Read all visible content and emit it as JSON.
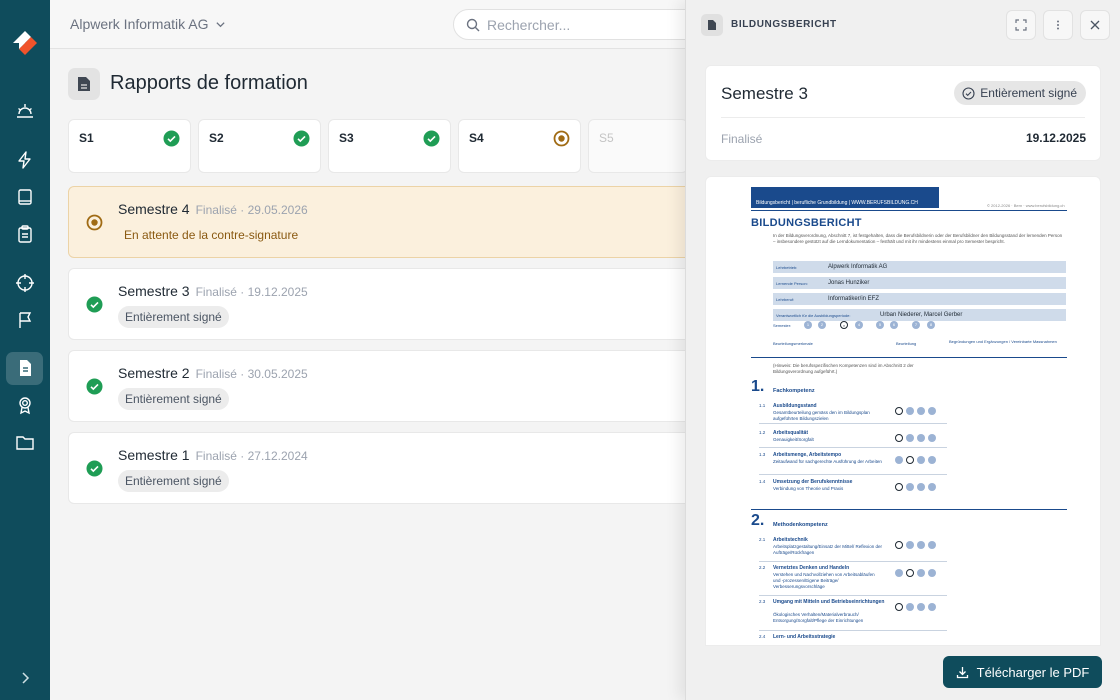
{
  "app": {
    "org_name": "Alpwerk Informatik AG",
    "search_placeholder": "Rechercher...",
    "page_title": "Rapports de formation"
  },
  "sidebar": {
    "items": [
      {
        "icon": "sunrise-icon"
      },
      {
        "icon": "lightning-icon"
      },
      {
        "icon": "book-icon"
      },
      {
        "icon": "clipboard-icon"
      },
      {
        "icon": "target-icon"
      },
      {
        "icon": "flag-icon"
      },
      {
        "icon": "document-icon",
        "active": true
      },
      {
        "icon": "award-icon"
      },
      {
        "icon": "folder-icon"
      }
    ]
  },
  "tabs": [
    {
      "label": "S1",
      "state": "done"
    },
    {
      "label": "S2",
      "state": "done"
    },
    {
      "label": "S3",
      "state": "done"
    },
    {
      "label": "S4",
      "state": "pending"
    },
    {
      "label": "S5",
      "state": "disabled"
    }
  ],
  "reports": [
    {
      "title": "Semestre 4",
      "meta": "Finalisé · 29.05.2026",
      "status": "En attente de la contre-signature",
      "state": "pending"
    },
    {
      "title": "Semestre 3",
      "meta": "Finalisé · 19.12.2025",
      "status": "Entièrement signé",
      "state": "done"
    },
    {
      "title": "Semestre 2",
      "meta": "Finalisé · 30.05.2025",
      "status": "Entièrement signé",
      "state": "done"
    },
    {
      "title": "Semestre 1",
      "meta": "Finalisé · 27.12.2024",
      "status": "Entièrement signé",
      "state": "done"
    }
  ],
  "drawer": {
    "title": "BILDUNGSBERICHT",
    "semester": "Semestre 3",
    "status": "Entièrement signé",
    "finalized_label": "Finalisé",
    "finalized_date": "19.12.2025",
    "download_label": "Télécharger le PDF"
  },
  "colors": {
    "sidebar": "#0f4c5c",
    "success": "#1f9d55",
    "pending": "#a06b14",
    "doc_blue": "#1a4a8c"
  },
  "document": {
    "bar_text": "Bildungsbericht | berufliche Grundbildung | WWW.BERUFSBILDUNG.CH",
    "copyright": "© 2012-2026 · Bern · www.berufsbildung.ch",
    "heading": "BILDUNGSBERICHT",
    "intro": "In der Bildungsverordnung, Abschnitt 7, ist festgehalten, dass die Berufsbildnerin oder der Berufsbildner den Bildungsstand der lernenden Person – insbesondere gestützt auf die Lerndokumentation – festhält und mit ihr mindestens einmal pro Semester bespricht.",
    "fields": [
      {
        "label": "Lehrbetrieb:",
        "value": "Alpwerk Informatik AG"
      },
      {
        "label": "Lernende Person:",
        "value": "Jonas Hunziker"
      },
      {
        "label": "Lehrberuf:",
        "value": "Informatiker/in EFZ"
      },
      {
        "label": "Verantwortlich für die Ausbildungsperiode:",
        "value": "Urban Niederer, Marcel Gerber"
      }
    ],
    "semester_label": "Semester:",
    "columns": [
      "Beurteilungsmerkmale",
      "Beurteilung",
      "Begründungen und Ergänzungen / Vereinbarte Massnahmen"
    ],
    "section_hint": "(Hinweis: Die berufsspezifischen Kompetenzen sind im Abschnitt 2 der Bildungsverordnung aufgeführt.)",
    "sections": [
      {
        "num": "1.",
        "title": "Fachkompetenz",
        "items": [
          {
            "num": "1.1",
            "title": "Ausbildungsstand",
            "sub": "Gesamtbeurteilung gemäss den im Bildungsplan aufgeführten Bildungszielen",
            "mark": 0
          },
          {
            "num": "1.2",
            "title": "Arbeitsqualität",
            "sub": "Genauigkeit/Sorgfalt",
            "mark": 0
          },
          {
            "num": "1.3",
            "title": "Arbeitsmenge, Arbeitstempo",
            "sub": "Zeitaufwand für sachgerechte Ausführung der Arbeiten",
            "mark": 1
          },
          {
            "num": "1.4",
            "title": "Umsetzung der Berufskenntnisse",
            "sub": "Verbindung von Theorie und Praxis",
            "mark": 0
          }
        ]
      },
      {
        "num": "2.",
        "title": "Methodenkompetenz",
        "items": [
          {
            "num": "2.1",
            "title": "Arbeitstechnik",
            "sub": "Arbeitsplatzgestaltung/Einsatz der Mittel/ Reflexion der Aufträge/Rückfragen",
            "mark": 0
          },
          {
            "num": "2.2",
            "title": "Vernetztes Denken und Handeln",
            "sub": "Verstehen und Nachvollziehen von Arbeitsabläufen und -prozessen/Eigene Beiträge/ Verbesserungsvorschläge",
            "mark": 1
          },
          {
            "num": "2.3",
            "title": "Umgang mit Mitteln und Betriebseinrichtungen",
            "sub": "Ökologisches Verhalten/Materialverbrauch/ Entsorgung/Sorgfalt/Pflege der Einrichtungen",
            "mark": 0
          },
          {
            "num": "2.4",
            "title": "Lern- und Arbeitsstrategie",
            "sub": "",
            "mark": 0
          }
        ]
      }
    ]
  }
}
